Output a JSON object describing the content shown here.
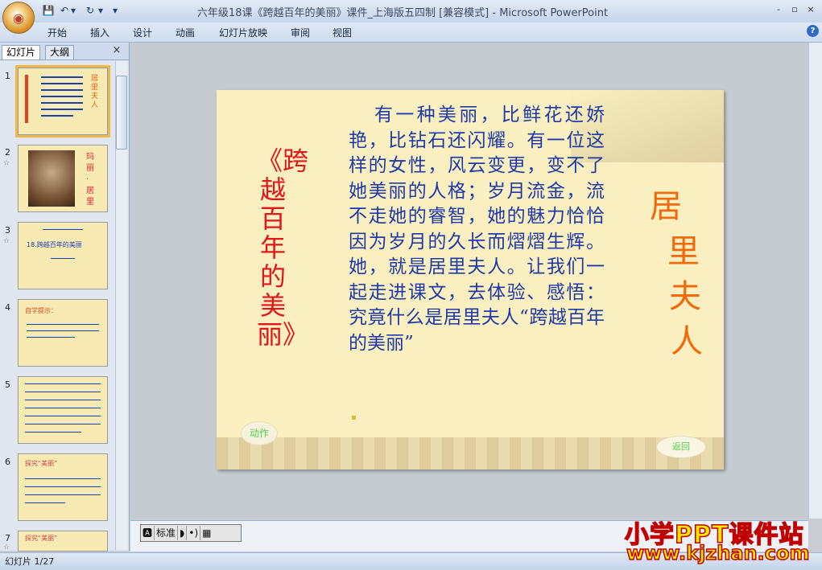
{
  "window": {
    "title": "六年级18课《跨越百年的美丽》课件_上海版五四制 [兼容模式] - Microsoft PowerPoint",
    "min": "-",
    "max": "▫",
    "close": "×"
  },
  "qat": {
    "save": "💾",
    "undo": "↶",
    "undo_menu": "▾",
    "redo": "↻",
    "redo_menu": "▾",
    "customize": "▾"
  },
  "ribbon": {
    "tabs": [
      "开始",
      "插入",
      "设计",
      "动画",
      "幻灯片放映",
      "审阅",
      "视图"
    ],
    "help": "?"
  },
  "left_pane": {
    "tab_slides": "幻灯片",
    "tab_outline": "大纲",
    "close": "×",
    "slides": [
      {
        "num": "1",
        "selected": true,
        "title": "居里夫人"
      },
      {
        "num": "2",
        "selected": false,
        "title": "玛丽·居里"
      },
      {
        "num": "3",
        "selected": false,
        "title": "18.跨越百年的美丽"
      },
      {
        "num": "4",
        "selected": false,
        "title": "自学提示："
      },
      {
        "num": "5",
        "selected": false,
        "title": ""
      },
      {
        "num": "6",
        "selected": false,
        "title": "探究“美丽”"
      },
      {
        "num": "7",
        "selected": false,
        "title": "探究“美丽”"
      }
    ]
  },
  "slide": {
    "subject": "《跨越百年的美丽》",
    "body": "有一种美丽，比鲜花还娇艳，比钻石还闪耀。有一位这样的女性，风云变更，变不了她美丽的人格；岁月流金，流不走她的睿智，她的魅力恰恰因为岁月的久长而熠熠生辉。她，就是居里夫人。让我们一起走进课文，去体验、感悟：究竟什么是居里夫人“跨越百年的美丽”",
    "name_chars": [
      "居",
      "里",
      "夫",
      "人"
    ],
    "action_button": "动作",
    "back_button": "返回"
  },
  "viewbar": {
    "items": [
      "🅰",
      "标准",
      "◗",
      "•)",
      "▦"
    ]
  },
  "status": {
    "text": "幻灯片 1/27"
  },
  "watermark": {
    "line1": "小学PPT课件站",
    "line2": "www.kjzhan.com"
  }
}
